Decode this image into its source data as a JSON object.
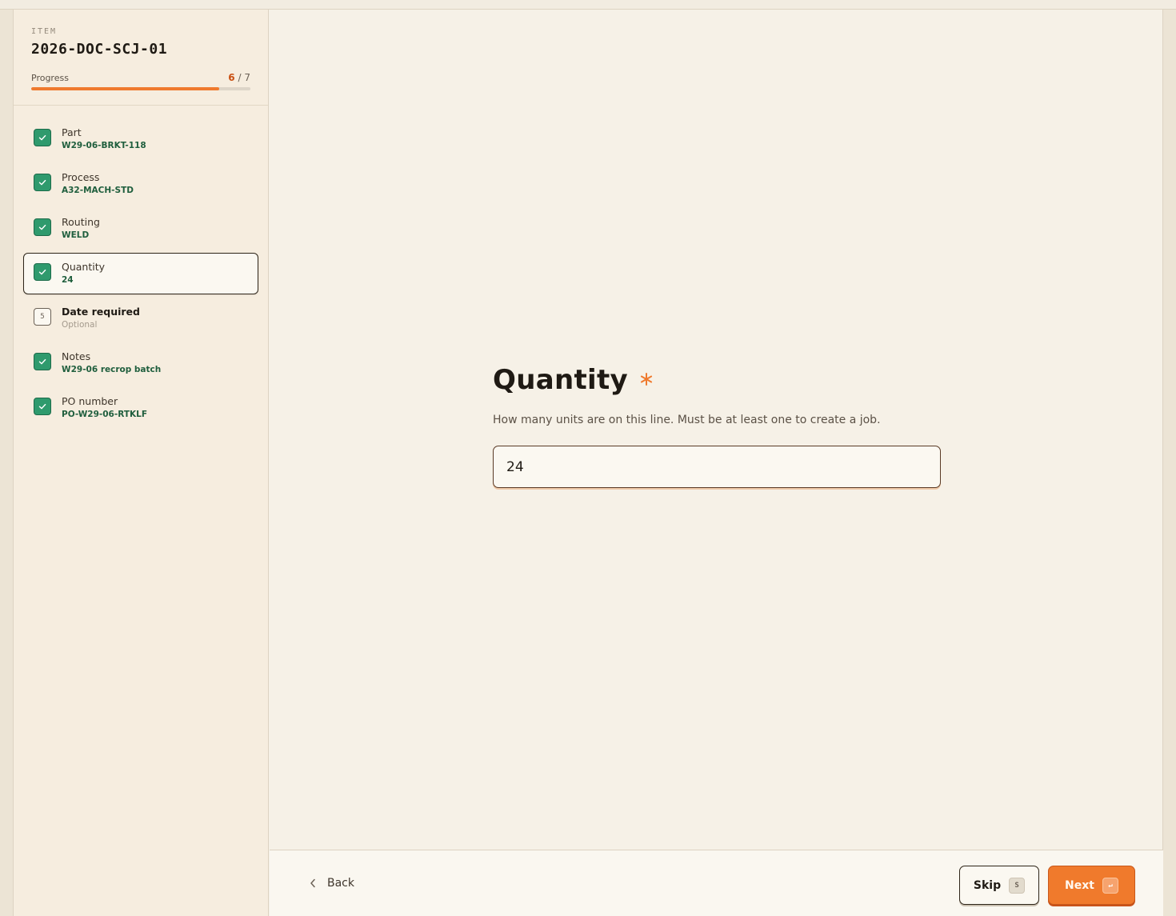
{
  "item": {
    "label": "ITEM",
    "id": "2026-DOC-SCJ-01"
  },
  "progress": {
    "label": "Progress",
    "current": "6",
    "separator": "/",
    "total": "7",
    "fraction": 0.857
  },
  "steps": [
    {
      "title": "Part",
      "value": "W29-06-BRKT-118",
      "status": "done"
    },
    {
      "title": "Process",
      "value": "A32-MACH-STD",
      "status": "done"
    },
    {
      "title": "Routing",
      "value": "WELD",
      "status": "done"
    },
    {
      "title": "Quantity",
      "value": "24",
      "status": "done",
      "active": true
    },
    {
      "title": "Date required",
      "value": "Optional",
      "status": "pending",
      "number": "5"
    },
    {
      "title": "Notes",
      "value": "W29-06 recrop batch",
      "status": "done"
    },
    {
      "title": "PO number",
      "value": "PO-W29-06-RTKLF",
      "status": "done"
    }
  ],
  "question": {
    "title": "Quantity",
    "required_mark": "*",
    "help": "How many units are on this line. Must be at least one to create a job.",
    "input_value": "24"
  },
  "footer": {
    "back_label": "Back",
    "skip_label": "Skip",
    "skip_key": "S",
    "next_label": "Next",
    "next_key": "↵"
  },
  "colors": {
    "accent": "#ef7a2e",
    "done": "#2f9a6d",
    "value_text": "#1f5e3d"
  }
}
